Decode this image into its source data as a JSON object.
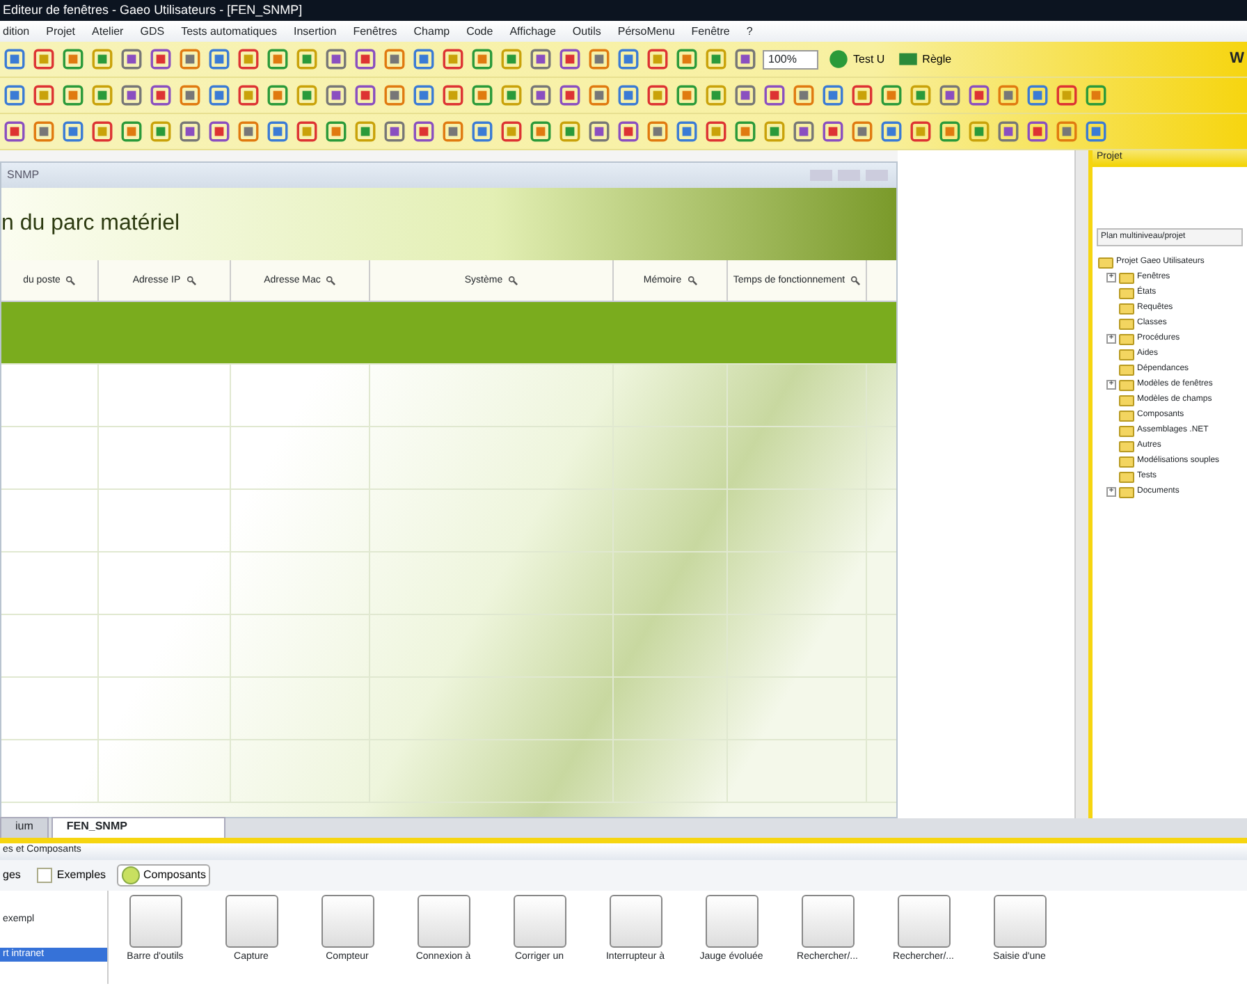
{
  "window": {
    "title": "Editeur de fenêtres - Gaeo Utilisateurs - [FEN_SNMP]"
  },
  "menu": [
    "dition",
    "Projet",
    "Atelier",
    "GDS",
    "Tests automatiques",
    "Insertion",
    "Fenêtres",
    "Champ",
    "Code",
    "Affichage",
    "Outils",
    "PérsoMenu",
    "Fenêtre",
    "?"
  ],
  "toolbar": {
    "zoom": "100%",
    "test_button": "Test U",
    "ruler_button": "Règle",
    "corner_letter": "W"
  },
  "editor": {
    "window_title": "SNMP",
    "heading": "n du parc matériel",
    "columns": [
      {
        "label": "du poste"
      },
      {
        "label": "Adresse IP"
      },
      {
        "label": "Adresse Mac"
      },
      {
        "label": "Système"
      },
      {
        "label": "Mémoire"
      },
      {
        "label": "Temps de fonctionnement"
      }
    ],
    "selected_row": true
  },
  "project_panel": {
    "title": "Projet",
    "view": "Plan multiniveau/projet",
    "tree": [
      {
        "label": "Projet Gaeo Utilisateurs",
        "children": [
          {
            "label": "Fenêtres",
            "expander": "+"
          },
          {
            "label": "États"
          },
          {
            "label": "Requêtes"
          },
          {
            "label": "Classes"
          },
          {
            "label": "Procédures",
            "expander": "+"
          },
          {
            "label": "Aides"
          },
          {
            "label": "Dépendances"
          },
          {
            "label": "Modèles de fenêtres",
            "expander": "+"
          },
          {
            "label": "Modèles de champs"
          },
          {
            "label": "Composants"
          },
          {
            "label": "Assemblages .NET"
          },
          {
            "label": "Autres"
          },
          {
            "label": "Modélisations souples"
          },
          {
            "label": "Tests"
          },
          {
            "label": "Documents",
            "expander": "+"
          }
        ]
      }
    ]
  },
  "doc_tabs": [
    {
      "label": "ium",
      "selected": false
    },
    {
      "label": "FEN_SNMP",
      "selected": true
    }
  ],
  "bottom_panel": {
    "title": "es et Composants",
    "tabs": [
      {
        "label": "ges",
        "selected": false
      },
      {
        "label": "Exemples",
        "selected": false
      },
      {
        "label": "Composants",
        "selected": true
      }
    ],
    "categories": [
      {
        "label": "exempl",
        "selected": false
      },
      {
        "label": "rt intranet",
        "selected": true
      }
    ],
    "components": [
      {
        "label": "Barre d'outils"
      },
      {
        "label": "Capture"
      },
      {
        "label": "Compteur"
      },
      {
        "label": "Connexion à"
      },
      {
        "label": "Corriger un"
      },
      {
        "label": "Interrupteur à"
      },
      {
        "label": "Jauge évoluée"
      },
      {
        "label": "Rechercher/..."
      },
      {
        "label": "Rechercher/..."
      },
      {
        "label": "Saisie d'une"
      }
    ]
  }
}
